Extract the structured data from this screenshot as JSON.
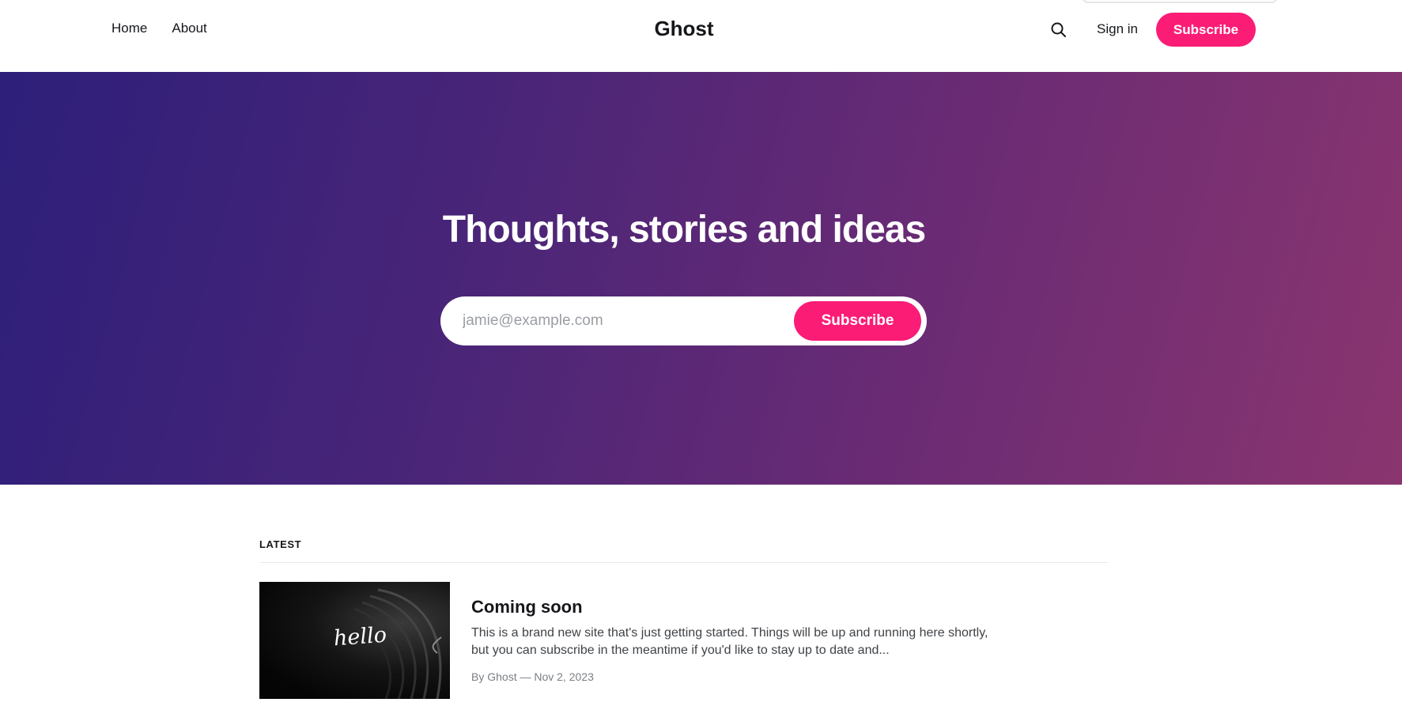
{
  "header": {
    "nav": [
      {
        "label": "Home"
      },
      {
        "label": "About"
      }
    ],
    "site_title": "Ghost",
    "search_icon": "search-icon",
    "signin_label": "Sign in",
    "subscribe_label": "Subscribe"
  },
  "hero": {
    "title": "Thoughts, stories and ideas",
    "email_placeholder": "jamie@example.com",
    "subscribe_label": "Subscribe",
    "gradient_colors": [
      "#2d1f7a",
      "#8a356f"
    ]
  },
  "latest": {
    "label": "LATEST",
    "posts": [
      {
        "thumbnail_text": "hello",
        "title": "Coming soon",
        "excerpt": "This is a brand new site that's just getting started. Things will be up and running here shortly, but you can subscribe in the meantime if you'd like to stay up to date and...",
        "meta": "By Ghost — Nov 2, 2023"
      }
    ]
  },
  "colors": {
    "accent": "#fb1c76",
    "text": "#15171a"
  }
}
